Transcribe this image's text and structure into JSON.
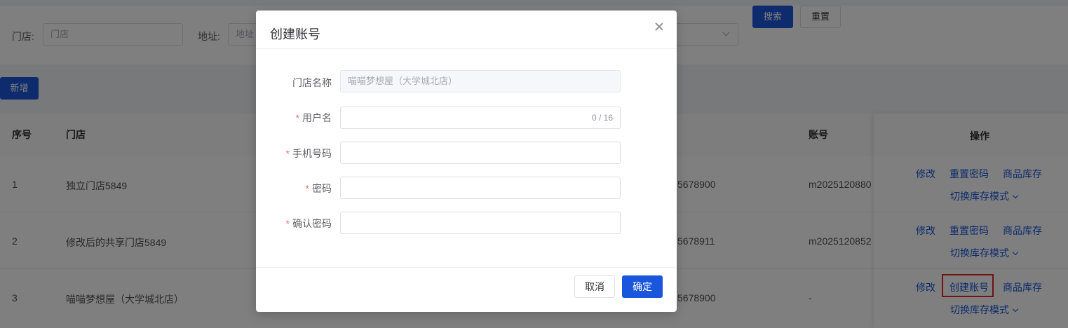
{
  "filters": {
    "store_label": "门店:",
    "store_placeholder": "门店",
    "address_label": "地址:",
    "address_placeholder": "地址",
    "search_button": "搜索",
    "reset_button": "重置"
  },
  "toolbar": {
    "add_button": "新增"
  },
  "table": {
    "headers": {
      "index": "序号",
      "store": "门店",
      "account": "账号",
      "actions": "操作"
    },
    "rows": [
      {
        "index": "1",
        "store": "独立门店5849",
        "phone": "5678900",
        "account": "m2025120880",
        "actions": [
          "修改",
          "重置密码",
          "商品库存",
          "切换库存模式"
        ]
      },
      {
        "index": "2",
        "store": "修改后的共享门店5849",
        "phone": "5678911",
        "account": "m2025120852",
        "actions": [
          "修改",
          "重置密码",
          "商品库存",
          "切换库存模式"
        ]
      },
      {
        "index": "3",
        "store": "喵喵梦想屋（大学城北店）",
        "phone": "5678900",
        "account": "-",
        "actions": [
          "修改",
          "创建账号",
          "商品库存",
          "切换库存模式"
        ]
      }
    ]
  },
  "dialog": {
    "title": "创建账号",
    "fields": {
      "store_name": {
        "label": "门店名称",
        "value": "喵喵梦想屋（大学城北店）"
      },
      "username": {
        "label": "用户名",
        "value": "",
        "counter": "0 / 16"
      },
      "phone": {
        "label": "手机号码",
        "value": ""
      },
      "password": {
        "label": "密码",
        "value": ""
      },
      "confirm_password": {
        "label": "确认密码",
        "value": ""
      }
    },
    "required_mark": "*",
    "cancel_button": "取消",
    "confirm_button": "确定"
  },
  "colors": {
    "primary": "#1a56db",
    "required": "#f56c6c",
    "highlight": "#e02424"
  }
}
